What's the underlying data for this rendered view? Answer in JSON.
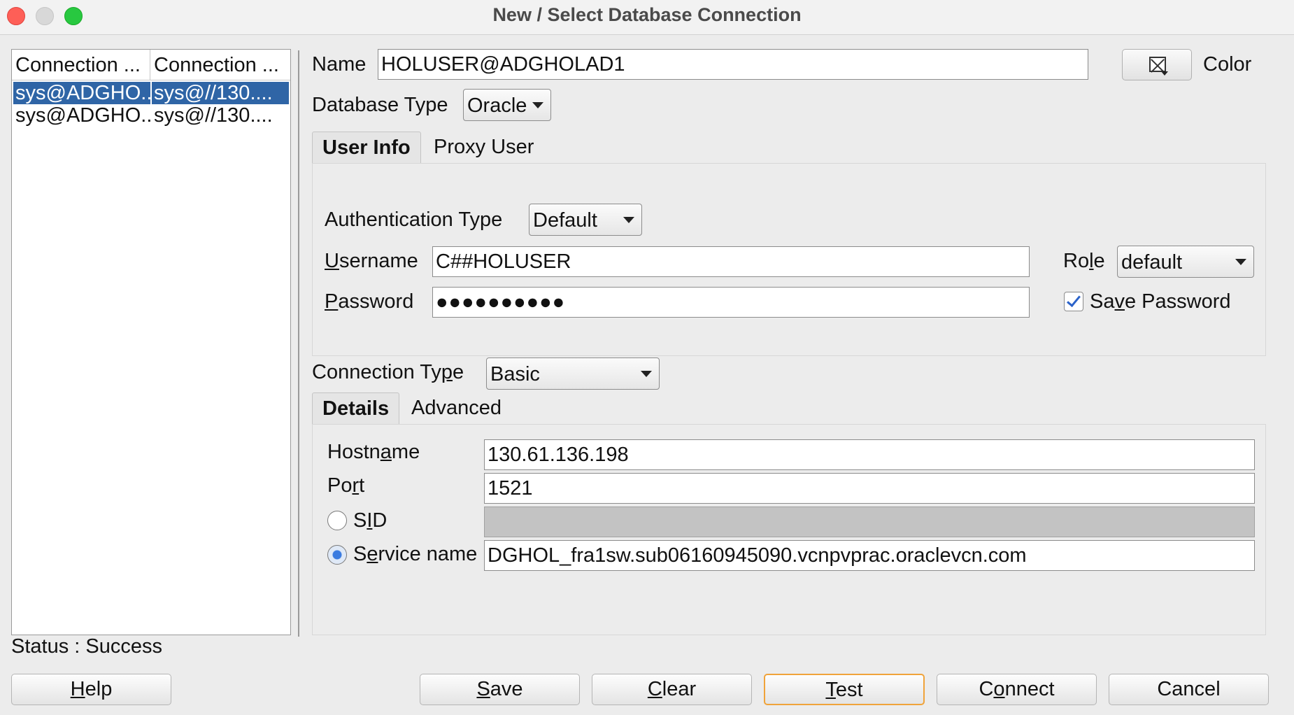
{
  "window": {
    "title": "New / Select Database Connection"
  },
  "connections": {
    "columns": [
      "Connection ...",
      "Connection ..."
    ],
    "rows": [
      {
        "name": "sys@ADGHO...",
        "details": "sys@//130...."
      },
      {
        "name": "sys@ADGHO...",
        "details": "sys@//130...."
      }
    ]
  },
  "status": {
    "text": "Status : Success"
  },
  "form": {
    "name_label": "Name",
    "name_value": "HOLUSER@ADGHOLAD1",
    "color_label": "Color",
    "db_type_label": "Database Type",
    "db_type_value": "Oracle",
    "tabs": {
      "user_info": "User Info",
      "proxy_user": "Proxy User"
    },
    "auth_type_label": "Authentication Type",
    "auth_type_value": "Default",
    "username_label_pre": "U",
    "username_label_rest": "sername",
    "username_value": "C##HOLUSER",
    "role_label_pre": "Ro",
    "role_label_u": "l",
    "role_label_rest": "e",
    "role_value": "default",
    "password_label_pre": "P",
    "password_label_rest": "assword",
    "password_value": "●●●●●●●●●●",
    "save_password_pre": "Sa",
    "save_password_u": "v",
    "save_password_rest": "e Password",
    "save_password_checked": true,
    "conn_type_label_pre": "Connection Ty",
    "conn_type_label_u": "p",
    "conn_type_label_rest": "e",
    "conn_type_value": "Basic",
    "detail_tabs": {
      "details": "Details",
      "advanced": "Advanced"
    },
    "hostname_label_pre": "Hostn",
    "hostname_label_u": "a",
    "hostname_label_rest": "me",
    "hostname_value": "130.61.136.198",
    "port_label_pre": "Po",
    "port_label_u": "r",
    "port_label_rest": "t",
    "port_value": "1521",
    "sid_label_pre": "S",
    "sid_label_u": "I",
    "sid_label_rest": "D",
    "sid_value": "",
    "service_label_pre": "S",
    "service_label_u": "e",
    "service_label_rest": "rvice name",
    "service_value": "DGHOL_fra1sw.sub06160945090.vcnpvprac.oraclevcn.com"
  },
  "buttons": {
    "help_u": "H",
    "help_rest": "elp",
    "save_u": "S",
    "save_rest": "ave",
    "clear_u": "C",
    "clear_rest": "lear",
    "test_u": "T",
    "test_rest": "est",
    "connect_pre": "C",
    "connect_u": "o",
    "connect_rest": "nnect",
    "cancel": "Cancel"
  },
  "colors": {
    "selection": "#2f65a6",
    "default_button_border": "#f0a33a",
    "checkmark": "#2a62c9"
  }
}
